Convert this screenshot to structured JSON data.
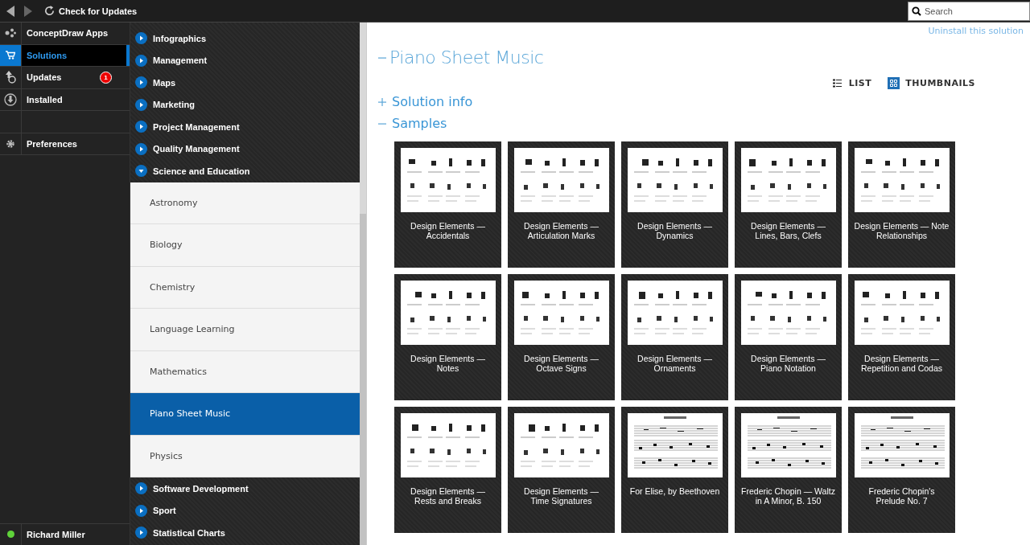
{
  "toolbar": {
    "update_button": "Check for Updates",
    "search": {
      "placeholder": "Search"
    }
  },
  "nav": {
    "items": [
      {
        "label": "ConceptDraw Apps",
        "selected": false
      },
      {
        "label": "Solutions",
        "selected": true
      },
      {
        "label": "Updates",
        "selected": false,
        "badge": "1"
      },
      {
        "label": "Installed",
        "selected": false
      }
    ],
    "settings_items": [
      {
        "label": "Preferences",
        "selected": false
      }
    ],
    "user": {
      "name": "Richard Miller",
      "online": true
    }
  },
  "categories": [
    {
      "label": "Infographics",
      "expanded": false
    },
    {
      "label": "Management",
      "expanded": false
    },
    {
      "label": "Maps",
      "expanded": false
    },
    {
      "label": "Marketing",
      "expanded": false
    },
    {
      "label": "Project Management",
      "expanded": false
    },
    {
      "label": "Quality Management",
      "expanded": false
    },
    {
      "label": "Science and Education",
      "expanded": true,
      "children": [
        {
          "label": "Astronomy",
          "selected": false
        },
        {
          "label": "Biology",
          "selected": false
        },
        {
          "label": "Chemistry",
          "selected": false
        },
        {
          "label": "Language Learning",
          "selected": false
        },
        {
          "label": "Mathematics",
          "selected": false
        },
        {
          "label": "Piano Sheet Music",
          "selected": true
        },
        {
          "label": "Physics",
          "selected": false
        }
      ]
    },
    {
      "label": "Software Development",
      "expanded": false
    },
    {
      "label": "Sport",
      "expanded": false
    },
    {
      "label": "Statistical Charts",
      "expanded": false
    }
  ],
  "main": {
    "uninstall_link": "Uninstall this solution",
    "title": "Piano Sheet Music",
    "title_expanded": true,
    "views": [
      {
        "label": "LIST",
        "selected": false
      },
      {
        "label": "THUMBNAILS",
        "selected": true
      }
    ],
    "sections": [
      {
        "label": "Solution info",
        "expanded": false
      },
      {
        "label": "Samples",
        "expanded": true
      }
    ],
    "samples": [
      {
        "title": "Design Elements — Accidentals"
      },
      {
        "title": "Design Elements — Articulation Marks"
      },
      {
        "title": "Design Elements — Dynamics"
      },
      {
        "title": "Design Elements — Lines, Bars, Clefs"
      },
      {
        "title": "Design Elements — Note Relationships"
      },
      {
        "title": "Design Elements — Notes"
      },
      {
        "title": "Design Elements — Octave Signs"
      },
      {
        "title": "Design Elements — Ornaments"
      },
      {
        "title": "Design Elements — Piano Notation"
      },
      {
        "title": "Design Elements — Repetition and Codas"
      },
      {
        "title": "Design Elements — Rests and Breaks"
      },
      {
        "title": "Design Elements — Time Signatures"
      },
      {
        "title": "For Elise, by Beethoven"
      },
      {
        "title": "Frederic Chopin — Waltz in A Minor, B. 150"
      },
      {
        "title": "Frederic Chopin's Prelude No. 7"
      }
    ]
  }
}
